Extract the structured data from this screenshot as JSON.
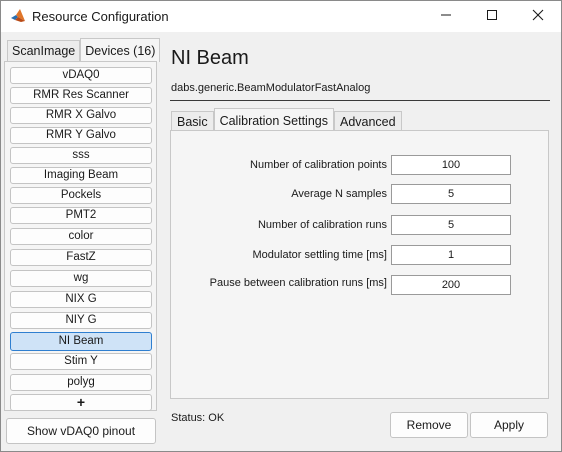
{
  "window": {
    "title": "Resource Configuration"
  },
  "left": {
    "tabs": [
      {
        "label": "ScanImage"
      },
      {
        "label": "Devices (16)"
      }
    ],
    "devices": [
      {
        "label": "vDAQ0"
      },
      {
        "label": "RMR Res Scanner"
      },
      {
        "label": "RMR X Galvo"
      },
      {
        "label": "RMR Y Galvo"
      },
      {
        "label": "sss"
      },
      {
        "label": "Imaging Beam"
      },
      {
        "label": "Pockels"
      },
      {
        "label": "PMT2"
      },
      {
        "label": "color"
      },
      {
        "label": "FastZ"
      },
      {
        "label": "wg"
      },
      {
        "label": "NIX G"
      },
      {
        "label": "NIY G"
      },
      {
        "label": "NI Beam"
      },
      {
        "label": "Stim Y"
      },
      {
        "label": "polyg"
      }
    ],
    "selected_device": "NI Beam",
    "add_label": "+",
    "pinout_label": "Show vDAQ0 pinout"
  },
  "main": {
    "title": "NI Beam",
    "class_name": "dabs.generic.BeamModulatorFastAnalog",
    "tabs": [
      {
        "label": "Basic"
      },
      {
        "label": "Calibration Settings"
      },
      {
        "label": "Advanced"
      }
    ],
    "active_tab": "Calibration Settings",
    "fields": [
      {
        "label": "Number of calibration points",
        "value": "100"
      },
      {
        "label": "Average N samples",
        "value": "5"
      },
      {
        "label": "Number of calibration runs",
        "value": "5"
      },
      {
        "label": "Modulator settling time [ms]",
        "value": "1"
      },
      {
        "label": "Pause between calibration runs [ms]",
        "value": "200"
      }
    ],
    "status": "Status: OK",
    "remove_label": "Remove",
    "apply_label": "Apply"
  },
  "icons": {
    "app": "matlab-icon",
    "minimize": "minimize-icon",
    "maximize": "maximize-icon",
    "close": "close-icon"
  }
}
